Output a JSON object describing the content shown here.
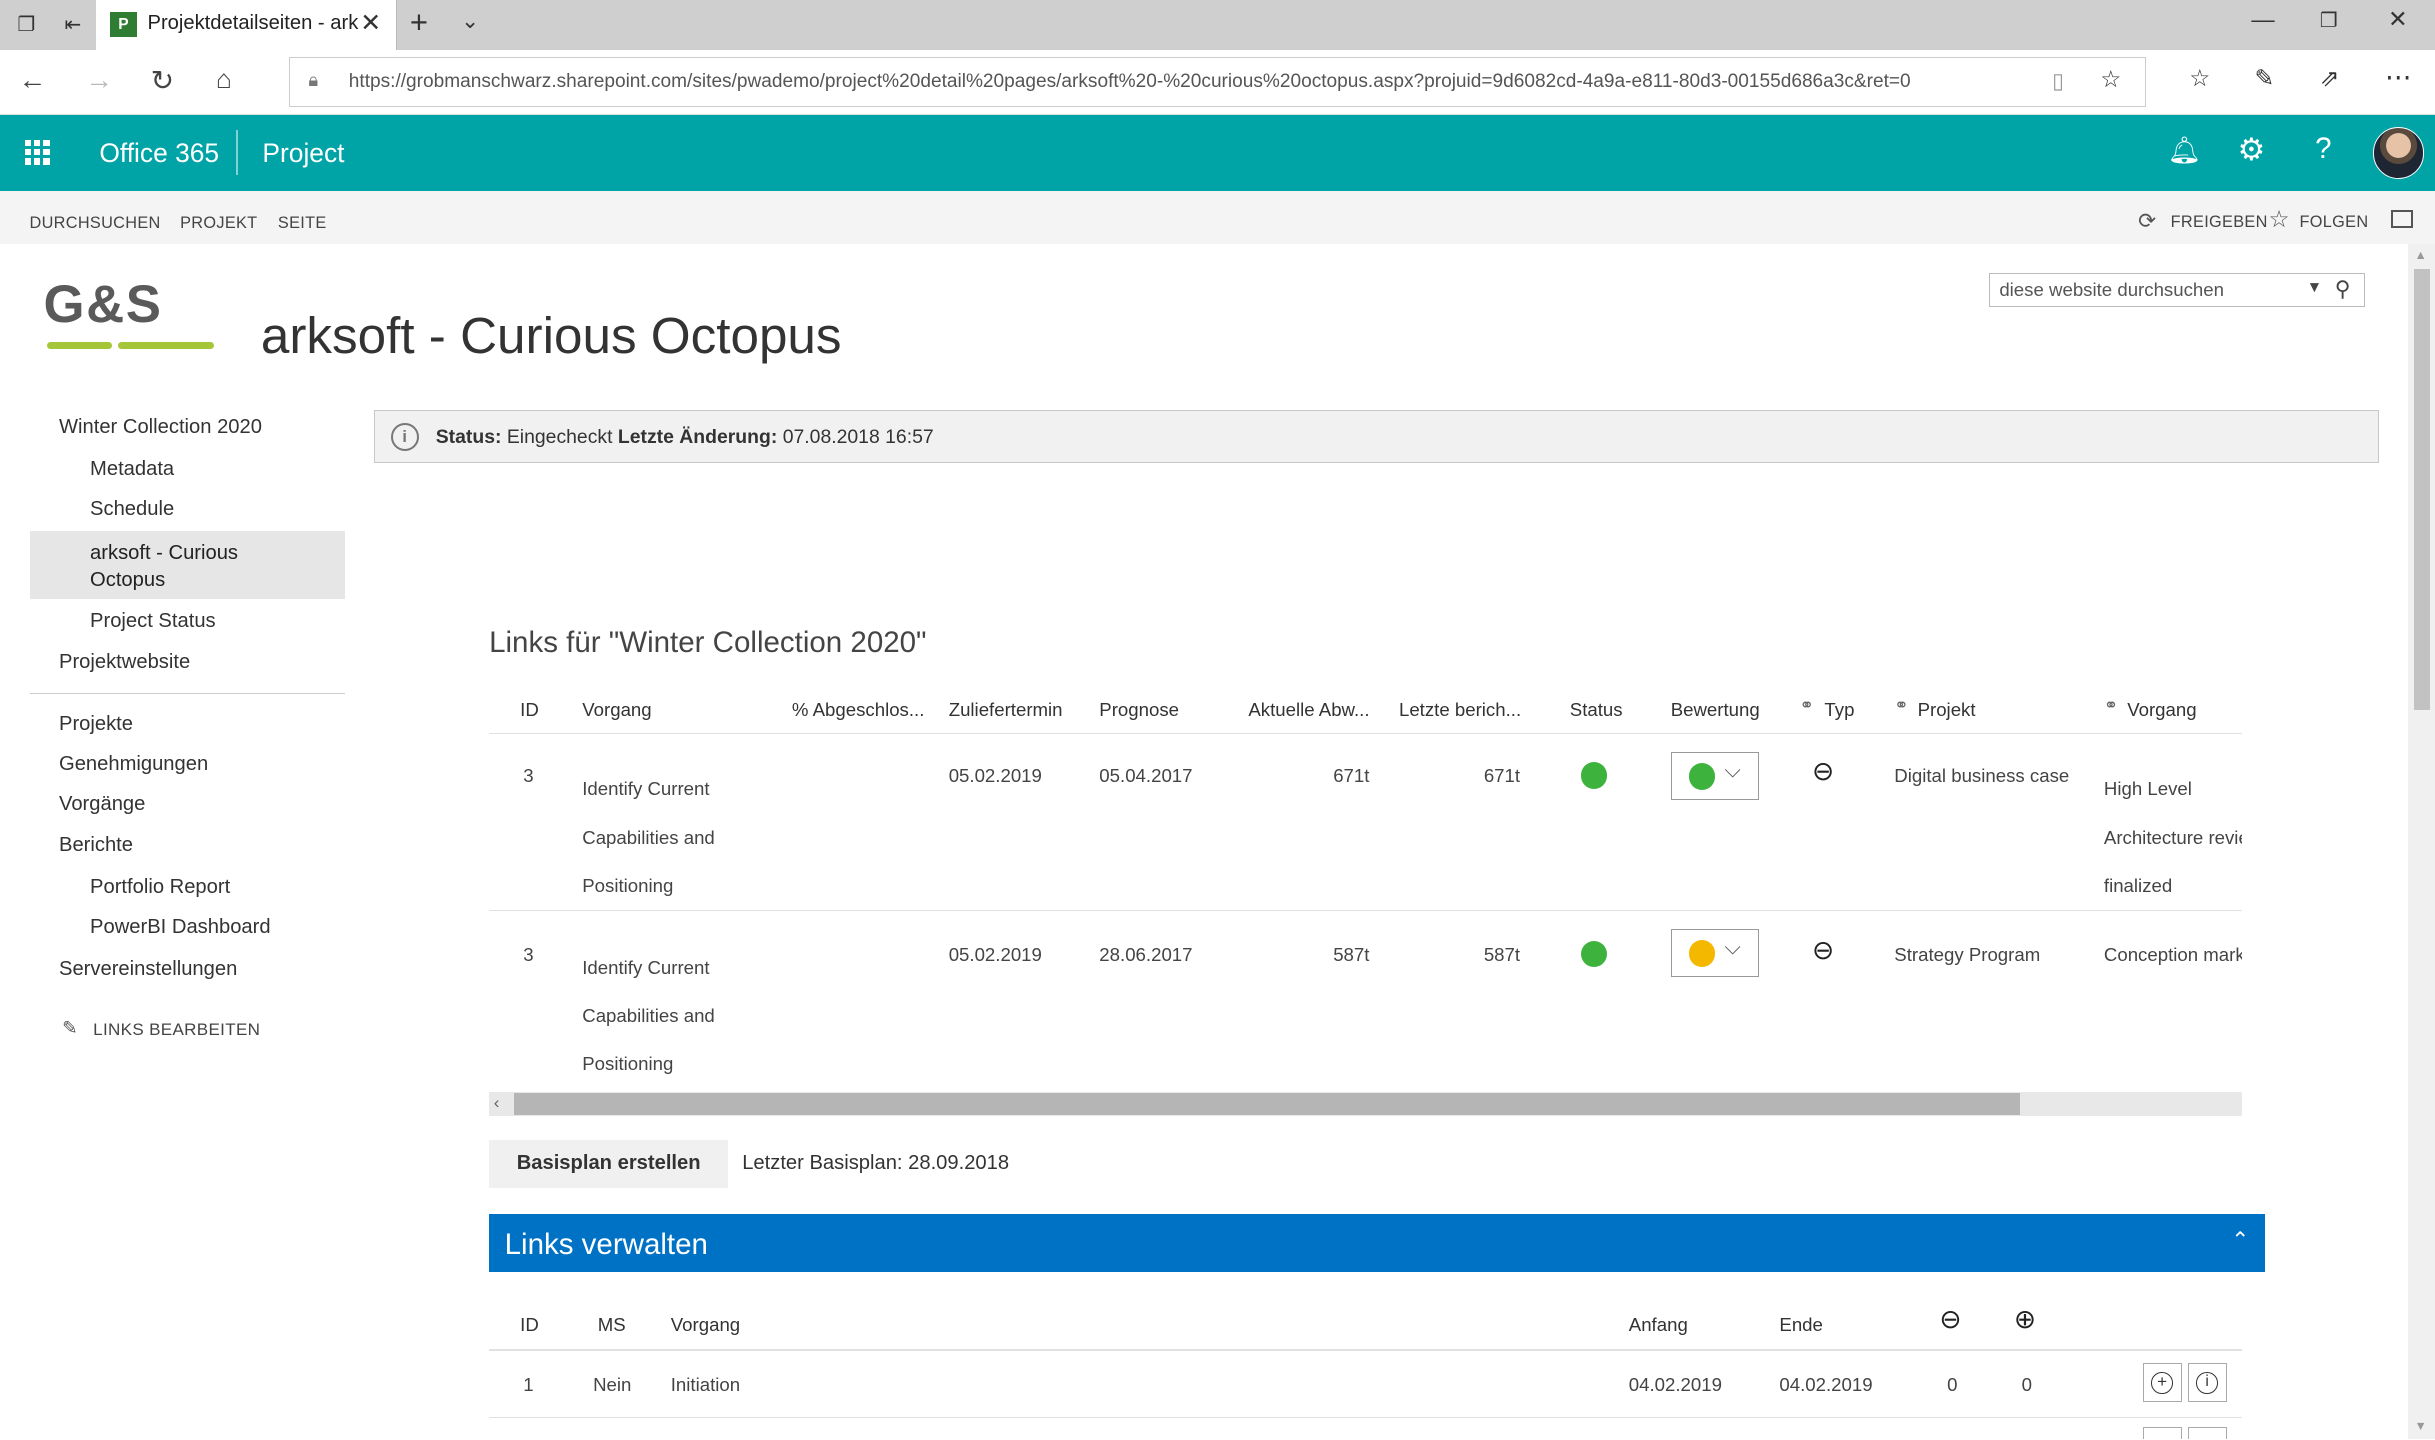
{
  "browser": {
    "tab_title": "Projektdetailseiten - ark",
    "url": "https://grobmanschwarz.sharepoint.com/sites/pwademo/project%20detail%20pages/arksoft%20-%20curious%20octopus.aspx?projuid=9d6082cd-4a9a-e811-80d3-00155d686a3c&ret=0"
  },
  "suite": {
    "app_launcher_icon": "waffle-icon",
    "product": "Office 365",
    "app": "Project"
  },
  "ribbon": {
    "tabs": [
      "DURCHSUCHEN",
      "PROJEKT",
      "SEITE"
    ],
    "share": "FREIGEBEN",
    "follow": "FOLGEN"
  },
  "site": {
    "logo_text": "G&S",
    "title": "arksoft - Curious Octopus",
    "search_placeholder": "diese website durchsuchen"
  },
  "quicklaunch": {
    "items": [
      "Winter Collection 2020",
      "Metadata",
      "Schedule",
      "arksoft - Curious Octopus",
      "Project Status",
      "Projektwebsite",
      "Projekte",
      "Genehmigungen",
      "Vorgänge",
      "Berichte",
      "Portfolio Report",
      "PowerBI Dashboard",
      "Servereinstellungen"
    ],
    "edit_links": "LINKS BEARBEITEN"
  },
  "status_bar": {
    "status_label": "Status:",
    "status_value": "Eingecheckt",
    "change_label": "Letzte Änderung:",
    "change_value": "07.08.2018 16:57"
  },
  "links_grid": {
    "title": "Links für \"Winter Collection 2020\"",
    "headers": [
      "ID",
      "Vorgang",
      "% Abgeschlos...",
      "Zuliefertermin",
      "Prognose",
      "Aktuelle Abw...",
      "Letzte berich...",
      "Status",
      "Bewertung",
      "Typ",
      "Projekt",
      "Vorgang"
    ],
    "rows": [
      {
        "id": "3",
        "task_lines": [
          "Identify Current",
          "Capabilities and",
          "Positioning"
        ],
        "pct": "",
        "due": "05.02.2019",
        "forecast": "05.04.2017",
        "dev": "671t",
        "last": "671t",
        "status_color": "#3db33d",
        "rating_color": "#3db33d",
        "project": "Digital business case",
        "task2_lines": [
          "High Level",
          "Architecture revie",
          "finalized"
        ]
      },
      {
        "id": "3",
        "task_lines": [
          "Identify Current",
          "Capabilities and",
          "Positioning"
        ],
        "pct": "",
        "due": "05.02.2019",
        "forecast": "28.06.2017",
        "dev": "587t",
        "last": "587t",
        "status_color": "#3db33d",
        "rating_color": "#f5b800",
        "project": "Strategy Program",
        "task2_lines": [
          "Conception mark"
        ]
      }
    ]
  },
  "baseline": {
    "button": "Basisplan erstellen",
    "last": "Letzter Basisplan: 28.09.2018"
  },
  "manage": {
    "title": "Links verwalten",
    "headers": [
      "ID",
      "MS",
      "Vorgang",
      "Anfang",
      "Ende"
    ],
    "rows": [
      {
        "id": "1",
        "ms": "Nein",
        "task": "Initiation",
        "start": "04.02.2019",
        "end": "04.02.2019",
        "pred": "0",
        "succ": "0"
      }
    ]
  }
}
